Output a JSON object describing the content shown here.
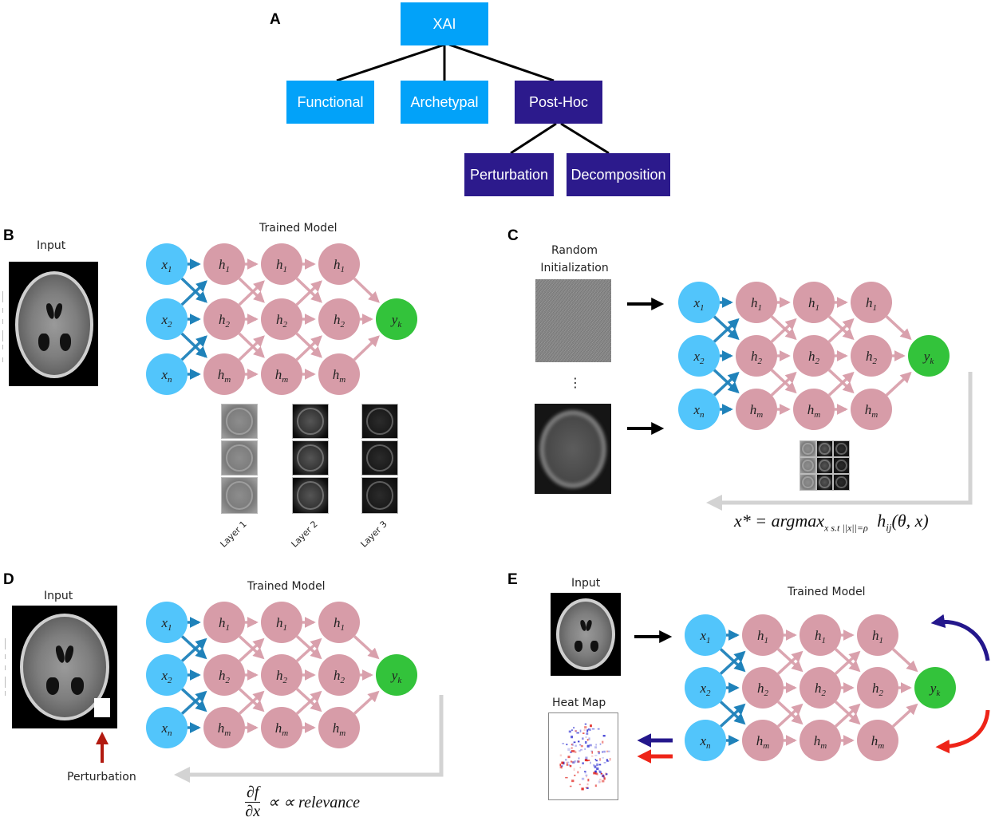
{
  "panels": {
    "A": {
      "letter": "A",
      "root": "XAI",
      "level1": [
        "Functional",
        "Archetypal",
        "Post-Hoc"
      ],
      "level2": [
        "Perturbation",
        "Decomposition"
      ],
      "colors": {
        "light_box": "#02a2f9",
        "dark_box": "#2c1a8c",
        "text": "#ffffff"
      }
    },
    "B": {
      "letter": "B",
      "input_label": "Input",
      "model_label": "Trained Model",
      "layer_labels": [
        "Layer 1",
        "Layer 2",
        "Layer 3"
      ]
    },
    "C": {
      "letter": "C",
      "init_label": "Random Initialization",
      "ellipsis": "⋮",
      "formula": {
        "lhs": "x* = argmax",
        "sub": "x s.t ||x||=ρ",
        "rhs": "h",
        "rhs_sub": "ij",
        "rhs_args": "(θ, x)"
      }
    },
    "D": {
      "letter": "D",
      "input_label": "Input",
      "model_label": "Trained Model",
      "perturbation_label": "Perturbation",
      "formula": {
        "num": "∂f",
        "den": "∂x",
        "rest": "∝ ∝ relevance"
      }
    },
    "E": {
      "letter": "E",
      "input_label": "Input",
      "model_label": "Trained Model",
      "heatmap_label": "Heat Map"
    }
  },
  "network": {
    "input_nodes": [
      {
        "base": "x",
        "sub": "1"
      },
      {
        "base": "x",
        "sub": "2"
      },
      {
        "base": "x",
        "sub": "n"
      }
    ],
    "hidden_nodes": [
      {
        "base": "h",
        "sub": "1"
      },
      {
        "base": "h",
        "sub": "2"
      },
      {
        "base": "h",
        "sub": "m"
      }
    ],
    "hidden_layers": 3,
    "output_node": {
      "base": "y",
      "sub": "k"
    },
    "colors": {
      "input": "#52c5fb",
      "hidden": "#d79ca8",
      "output": "#33c33b",
      "input_edge": "#1f82ba",
      "hidden_edge": "#d9a0ac",
      "feedback": "#d3d3d3",
      "black_arrow": "#000000",
      "blue_arrow": "#24178c",
      "red_arrow": "#ee2418",
      "perturb_arrow": "#b21a10"
    }
  }
}
